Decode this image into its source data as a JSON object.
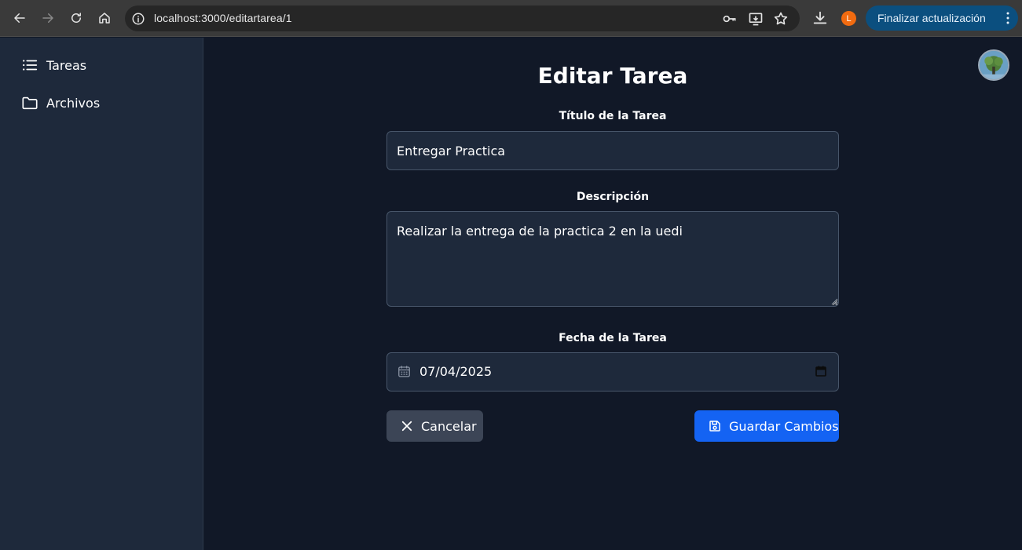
{
  "browser": {
    "url": "localhost:3000/editartarea/1",
    "profile_initial": "L",
    "update_label": "Finalizar actualización",
    "icons": [
      "back-icon",
      "forward-icon",
      "reload-icon",
      "home-icon",
      "info-icon",
      "key-icon",
      "install-app-icon",
      "star-icon",
      "download-icon",
      "kebab-menu-icon"
    ],
    "profile_color": "#f26b10",
    "update_color": "#0b4f7f"
  },
  "sidebar": {
    "items": [
      {
        "label": "Tareas",
        "icon": "list-icon"
      },
      {
        "label": "Archivos",
        "icon": "folder-icon"
      }
    ],
    "background": "#1e293b"
  },
  "form": {
    "title": "Editar Tarea",
    "titulo": {
      "label": "Título de la Tarea",
      "value": "Entregar Practica"
    },
    "descripcion": {
      "label": "Descripción",
      "value": "Realizar la entrega de la practica 2 en la uedi"
    },
    "fecha": {
      "label": "Fecha de la Tarea",
      "value": "07/04/2025"
    },
    "cancel_label": "Cancelar",
    "save_label": "Guardar Cambios",
    "cancel_color": "#3c4556",
    "save_color": "#1463f3"
  },
  "theme": {
    "page_background": "#111827",
    "input_background": "#1e293b",
    "input_border": "#475569"
  }
}
